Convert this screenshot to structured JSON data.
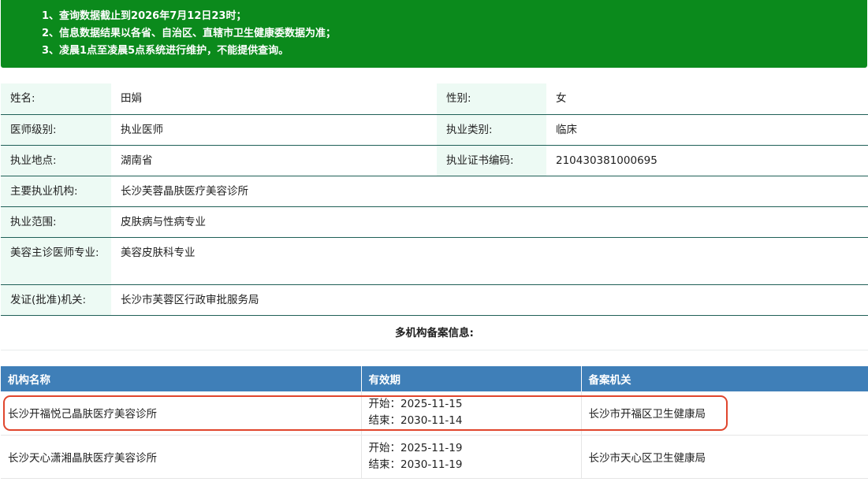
{
  "notice": {
    "lines": [
      "1、查询数据截止到2026年7月12日23时；",
      "2、信息数据结果以各省、自治区、直辖市卫生健康委数据为准；",
      "3、凌晨1点至凌晨5点系统进行维护，不能提供查询。"
    ]
  },
  "doctor": {
    "name_label": "姓名:",
    "name": "田娟",
    "gender_label": "性别:",
    "gender": "女",
    "level_label": "医师级别:",
    "level": "执业医师",
    "category_label": "执业类别:",
    "category": "临床",
    "location_label": "执业地点:",
    "location": "湖南省",
    "cert_label": "执业证书编码:",
    "cert_no": "210430381000695",
    "org_label": "主要执业机构:",
    "org": "长沙芙蓉晶肤医疗美容诊所",
    "scope_label": "执业范围:",
    "scope": "皮肤病与性病专业",
    "cosmetic_label": "美容主诊医师专业:",
    "cosmetic": "美容皮肤科专业",
    "issuer_label": "发证(批准)机关:",
    "issuer": "长沙市芙蓉区行政审批服务局"
  },
  "multi_org": {
    "title": "多机构备案信息:",
    "headers": [
      "机构名称",
      "有效期",
      "备案机关"
    ],
    "rows": [
      {
        "name": "长沙开福悦己晶肤医疗美容诊所",
        "start": "开始：2025-11-15",
        "end": "结束：2030-11-14",
        "authority": "长沙市开福区卫生健康局"
      },
      {
        "name": "长沙天心潇湘晶肤医疗美容诊所",
        "start": "开始：2025-11-19",
        "end": "结束：2030-11-19",
        "authority": "长沙市天心区卫生健康局"
      }
    ]
  },
  "colors": {
    "notice_bg": "#0b8a1c",
    "header_bg": "#3f7fb8",
    "label_bg": "#edfaf4",
    "highlight": "#e0462d"
  }
}
